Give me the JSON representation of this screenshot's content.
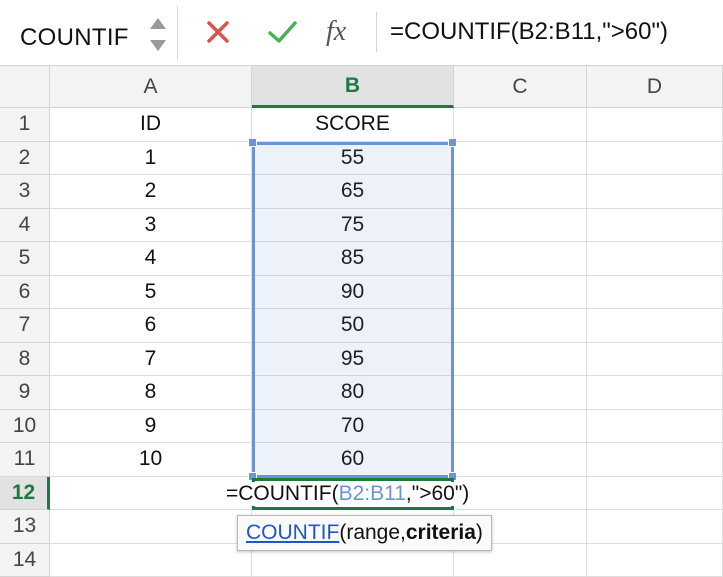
{
  "formula_bar": {
    "name_box": "COUNTIF",
    "fx_label": "fx",
    "formula": "=COUNTIF(B2:B11,\">60\")"
  },
  "columns": [
    "A",
    "B",
    "C",
    "D"
  ],
  "selected_column": "B",
  "rows": [
    {
      "n": "1",
      "a": "ID",
      "b": "SCORE"
    },
    {
      "n": "2",
      "a": "1",
      "b": "55"
    },
    {
      "n": "3",
      "a": "2",
      "b": "65"
    },
    {
      "n": "4",
      "a": "3",
      "b": "75"
    },
    {
      "n": "5",
      "a": "4",
      "b": "85"
    },
    {
      "n": "6",
      "a": "5",
      "b": "90"
    },
    {
      "n": "7",
      "a": "6",
      "b": "50"
    },
    {
      "n": "8",
      "a": "7",
      "b": "95"
    },
    {
      "n": "9",
      "a": "8",
      "b": "80"
    },
    {
      "n": "10",
      "a": "9",
      "b": "70"
    },
    {
      "n": "11",
      "a": "10",
      "b": "60"
    },
    {
      "n": "12",
      "a": "",
      "b": ""
    },
    {
      "n": "13",
      "a": "",
      "b": ""
    },
    {
      "n": "14",
      "a": "",
      "b": ""
    }
  ],
  "active_row": "12",
  "edit_cell": {
    "prefix": "=COUNTIF(",
    "range_ref": "B2:B11",
    "suffix": ",\">60\")"
  },
  "tooltip": {
    "function_name": "COUNTIF",
    "open": "(",
    "arg1": "range, ",
    "arg2": "criteria",
    "close": ")"
  },
  "colors": {
    "accent_green": "#1d7a3e",
    "range_blue": "#6b93d6",
    "cancel_red": "#d9534f",
    "confirm_green": "#4caf50"
  }
}
